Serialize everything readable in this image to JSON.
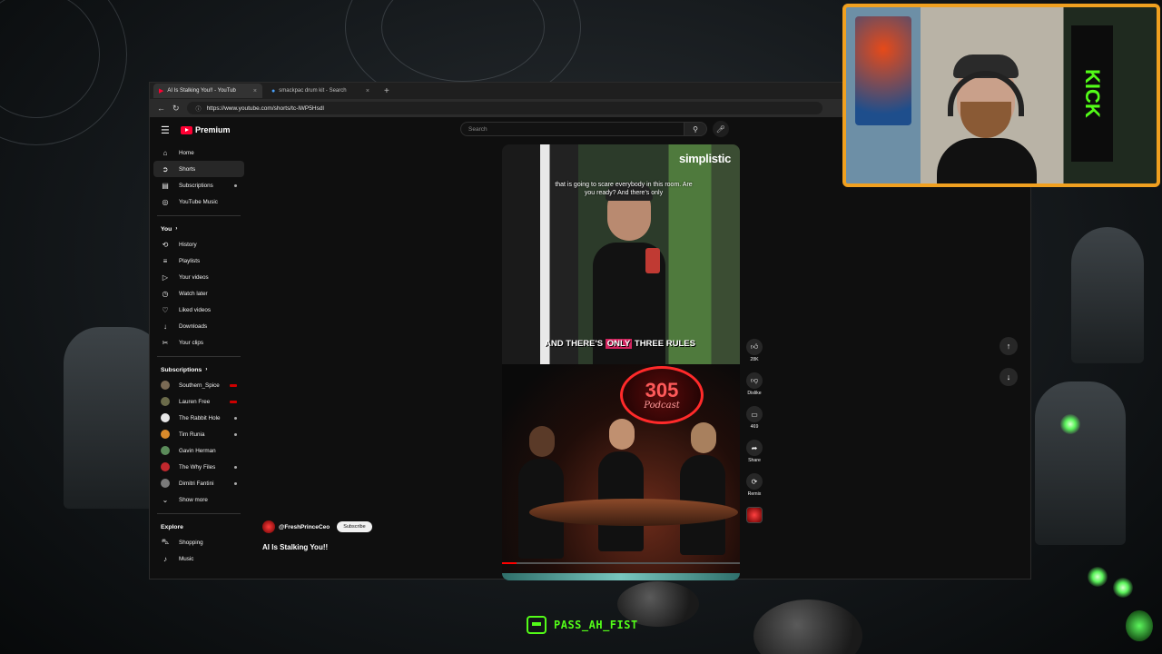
{
  "browser": {
    "tabs": [
      {
        "title": "AI Is Stalking You!! - YouTub",
        "active": true
      },
      {
        "title": "smackpac drum kit - Search",
        "active": false
      }
    ],
    "url": "https://www.youtube.com/shorts/tc-lWP5Hsdl"
  },
  "youtube": {
    "brand": "Premium",
    "search_placeholder": "Search",
    "sidebar": {
      "main": [
        {
          "label": "Home",
          "icon": "home-icon"
        },
        {
          "label": "Shorts",
          "icon": "shorts-icon",
          "active": true
        },
        {
          "label": "Subscriptions",
          "icon": "subscriptions-icon"
        },
        {
          "label": "YouTube Music",
          "icon": "music-icon"
        }
      ],
      "you_heading": "You",
      "you": [
        {
          "label": "History",
          "icon": "history-icon"
        },
        {
          "label": "Playlists",
          "icon": "playlists-icon"
        },
        {
          "label": "Your videos",
          "icon": "your-videos-icon"
        },
        {
          "label": "Watch later",
          "icon": "watch-later-icon"
        },
        {
          "label": "Liked videos",
          "icon": "liked-icon"
        },
        {
          "label": "Downloads",
          "icon": "download-icon"
        },
        {
          "label": "Your clips",
          "icon": "clips-icon"
        }
      ],
      "subscriptions_heading": "Subscriptions",
      "subscriptions": [
        {
          "label": "Southern_Spice",
          "color": "#7a6a55",
          "live": true
        },
        {
          "label": "Lauren Free",
          "color": "#6b6b4a",
          "live": true
        },
        {
          "label": "The Rabbit Hole",
          "color": "#e8e8e8",
          "live": false
        },
        {
          "label": "Tim Runia",
          "color": "#d98a2b",
          "live": false
        },
        {
          "label": "Gavin Herman",
          "color": "#5b8c5a",
          "live": false
        },
        {
          "label": "The Why Files",
          "color": "#c0282d",
          "live": false
        },
        {
          "label": "Dimitri Fantini",
          "color": "#7a7a7a",
          "live": false
        }
      ],
      "show_more": "Show more",
      "explore_heading": "Explore",
      "explore": [
        {
          "label": "Shopping",
          "icon": "shopping-icon"
        },
        {
          "label": "Music",
          "icon": "music-note-icon"
        }
      ]
    },
    "short": {
      "brand_overlay": "simplistic",
      "caption_top": "that is going to scare everybody in this room. Are you ready? And there's only",
      "caption_bottom_pre": "AND THERE'S ",
      "caption_bottom_highlight": "ONLY",
      "caption_bottom_post": " THREE RULES",
      "podcast_number": "305",
      "podcast_word": "Podcast",
      "progress": 0.06,
      "channel": "@FreshPrinceCeo",
      "subscribe_label": "Subscribe",
      "title": "AI Is Stalking You!!"
    },
    "actions": [
      {
        "icon": "like-icon",
        "label": "28K"
      },
      {
        "icon": "dislike-icon",
        "label": "Dislike"
      },
      {
        "icon": "comment-icon",
        "label": "469"
      },
      {
        "icon": "share-icon",
        "label": "Share"
      },
      {
        "icon": "remix-icon",
        "label": "Remix"
      }
    ]
  },
  "overlay": {
    "handle": "PASS_AH_FIST",
    "accent": "#53fc18",
    "frame_color": "#f0a020",
    "cam_banner": "KICK"
  }
}
